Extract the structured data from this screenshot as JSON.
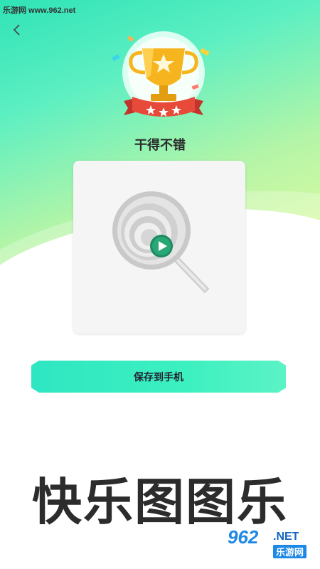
{
  "watermark_top": "乐游网 www.962.net",
  "header": {
    "back_icon": "chevron-left-icon"
  },
  "result": {
    "title": "干得不错"
  },
  "card": {
    "play_icon": "play-icon"
  },
  "actions": {
    "save_label": "保存到手机"
  },
  "promo": {
    "title": "快乐图图乐"
  },
  "watermark_logo": {
    "number": "962",
    "net": ".NET",
    "name": "乐游网"
  },
  "colors": {
    "accent": "#2ee6c2",
    "trophy": "#f6b51e",
    "ribbon": "#e84a3a"
  }
}
